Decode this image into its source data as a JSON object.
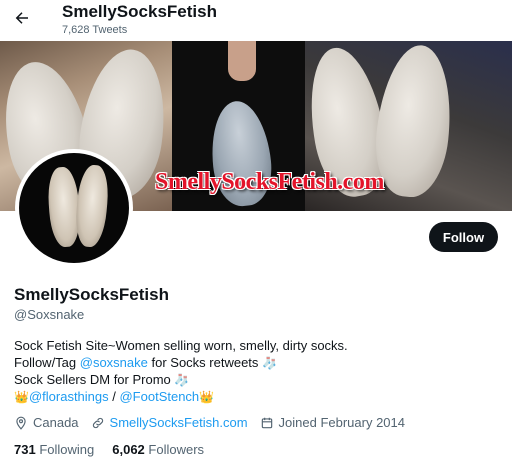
{
  "header": {
    "name": "SmellySocksFetish",
    "tweet_count": "7,628 Tweets"
  },
  "banner": {
    "text": "SmellySocksFetish.com"
  },
  "profile": {
    "display_name": "SmellySocksFetish",
    "handle": "@Soxsnake",
    "follow_label": "Follow"
  },
  "bio": {
    "line1": "Sock Fetish Site~Women selling worn, smelly, dirty socks.",
    "line2_prefix": "Follow/Tag ",
    "line2_link": "@soxsnake",
    "line2_suffix": " for Socks retweets ",
    "line3": "Sock Sellers DM for Promo ",
    "line4_link1": "@florasthings",
    "line4_sep": " / ",
    "line4_link2": "@FootStench",
    "sock_emoji": "🧦",
    "crown_emoji": "👑"
  },
  "meta": {
    "location": "Canada",
    "website": "SmellySocksFetish.com",
    "joined": "Joined February 2014"
  },
  "stats": {
    "following_count": "731",
    "following_label": "Following",
    "followers_count": "6,062",
    "followers_label": "Followers"
  },
  "icons": [
    "back-arrow-icon",
    "location-icon",
    "link-icon",
    "calendar-icon"
  ],
  "colors": {
    "accent": "#1d9bf0",
    "text": "#0f1419",
    "muted": "#536471",
    "button": "#0f1419"
  }
}
